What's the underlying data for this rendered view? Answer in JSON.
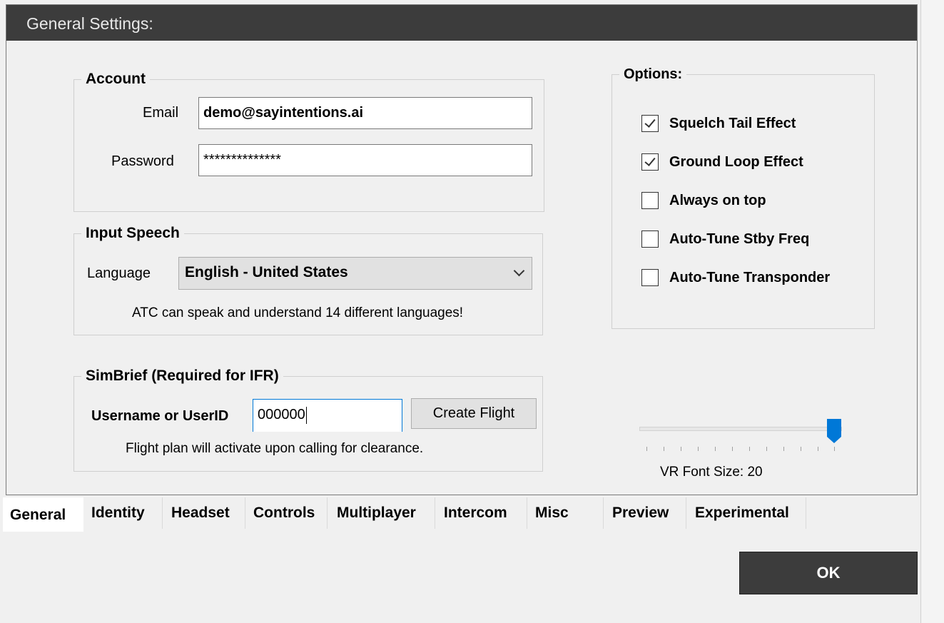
{
  "window": {
    "header_title": "General Settings:"
  },
  "account": {
    "title": "Account",
    "email_label": "Email",
    "email_value": "demo@sayintentions.ai",
    "password_label": "Password",
    "password_value": "**************"
  },
  "input_speech": {
    "title": "Input Speech",
    "language_label": "Language",
    "language_selected": "English - United States",
    "note": "ATC can speak and understand 14 different languages!"
  },
  "simbrief": {
    "title": "SimBrief (Required for IFR)",
    "username_label": "Username or UserID",
    "username_value": "000000",
    "create_flight_label": "Create Flight",
    "note": "Flight plan will activate upon calling for clearance."
  },
  "options": {
    "title": "Options:",
    "items": [
      {
        "label": "Squelch Tail Effect",
        "checked": true
      },
      {
        "label": "Ground Loop Effect",
        "checked": true
      },
      {
        "label": "Always on top",
        "checked": false
      },
      {
        "label": "Auto-Tune Stby Freq",
        "checked": false
      },
      {
        "label": "Auto-Tune Transponder",
        "checked": false
      }
    ]
  },
  "vr_font": {
    "label": "VR Font Size: 20",
    "value": 20,
    "slider_fraction": 0.96,
    "thumb_color": "#0078d7"
  },
  "tabs": [
    {
      "label": "General",
      "active": true
    },
    {
      "label": "Identity",
      "active": false
    },
    {
      "label": "Headset",
      "active": false
    },
    {
      "label": "Controls",
      "active": false
    },
    {
      "label": "Multiplayer",
      "active": false
    },
    {
      "label": "Intercom",
      "active": false
    },
    {
      "label": "Misc",
      "active": false
    },
    {
      "label": "Preview",
      "active": false
    },
    {
      "label": "Experimental",
      "active": false
    }
  ],
  "footer": {
    "ok_label": "OK"
  }
}
